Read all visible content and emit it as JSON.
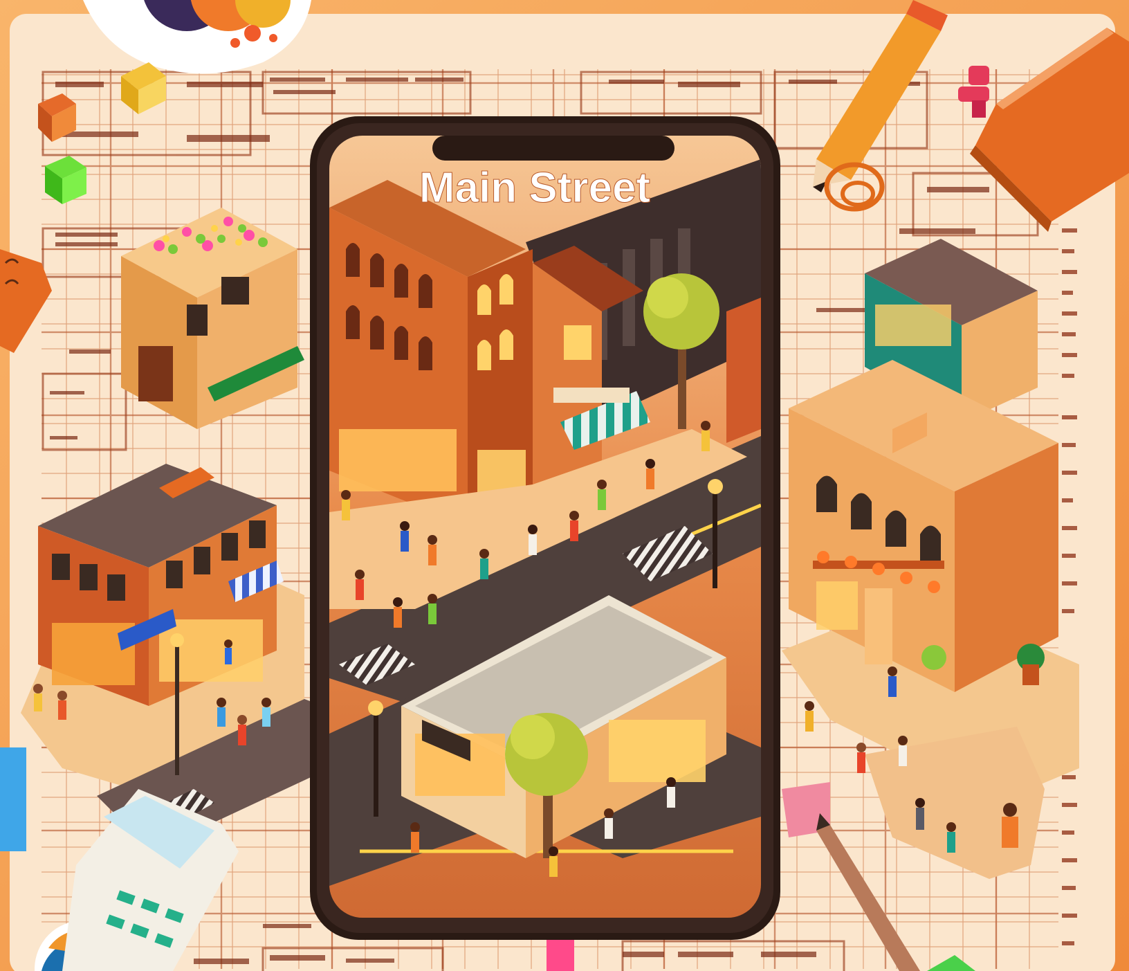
{
  "phone": {
    "title": "Main Street"
  },
  "colors": {
    "background": "#f7a24a",
    "paper": "#fbe7cf",
    "grid_line": "#c96a3a",
    "phone_frame": "#2a1a14",
    "title_text": "#ffffff",
    "brick": "#d8572a",
    "road": "#5b4a44",
    "tree": "#b8c53a"
  },
  "icons": [
    "logo-badge",
    "pencil-icon",
    "pen-icon",
    "calculator-icon",
    "paperclip-icon",
    "pushpin-icon",
    "street-lamp-icon",
    "tree-icon"
  ]
}
